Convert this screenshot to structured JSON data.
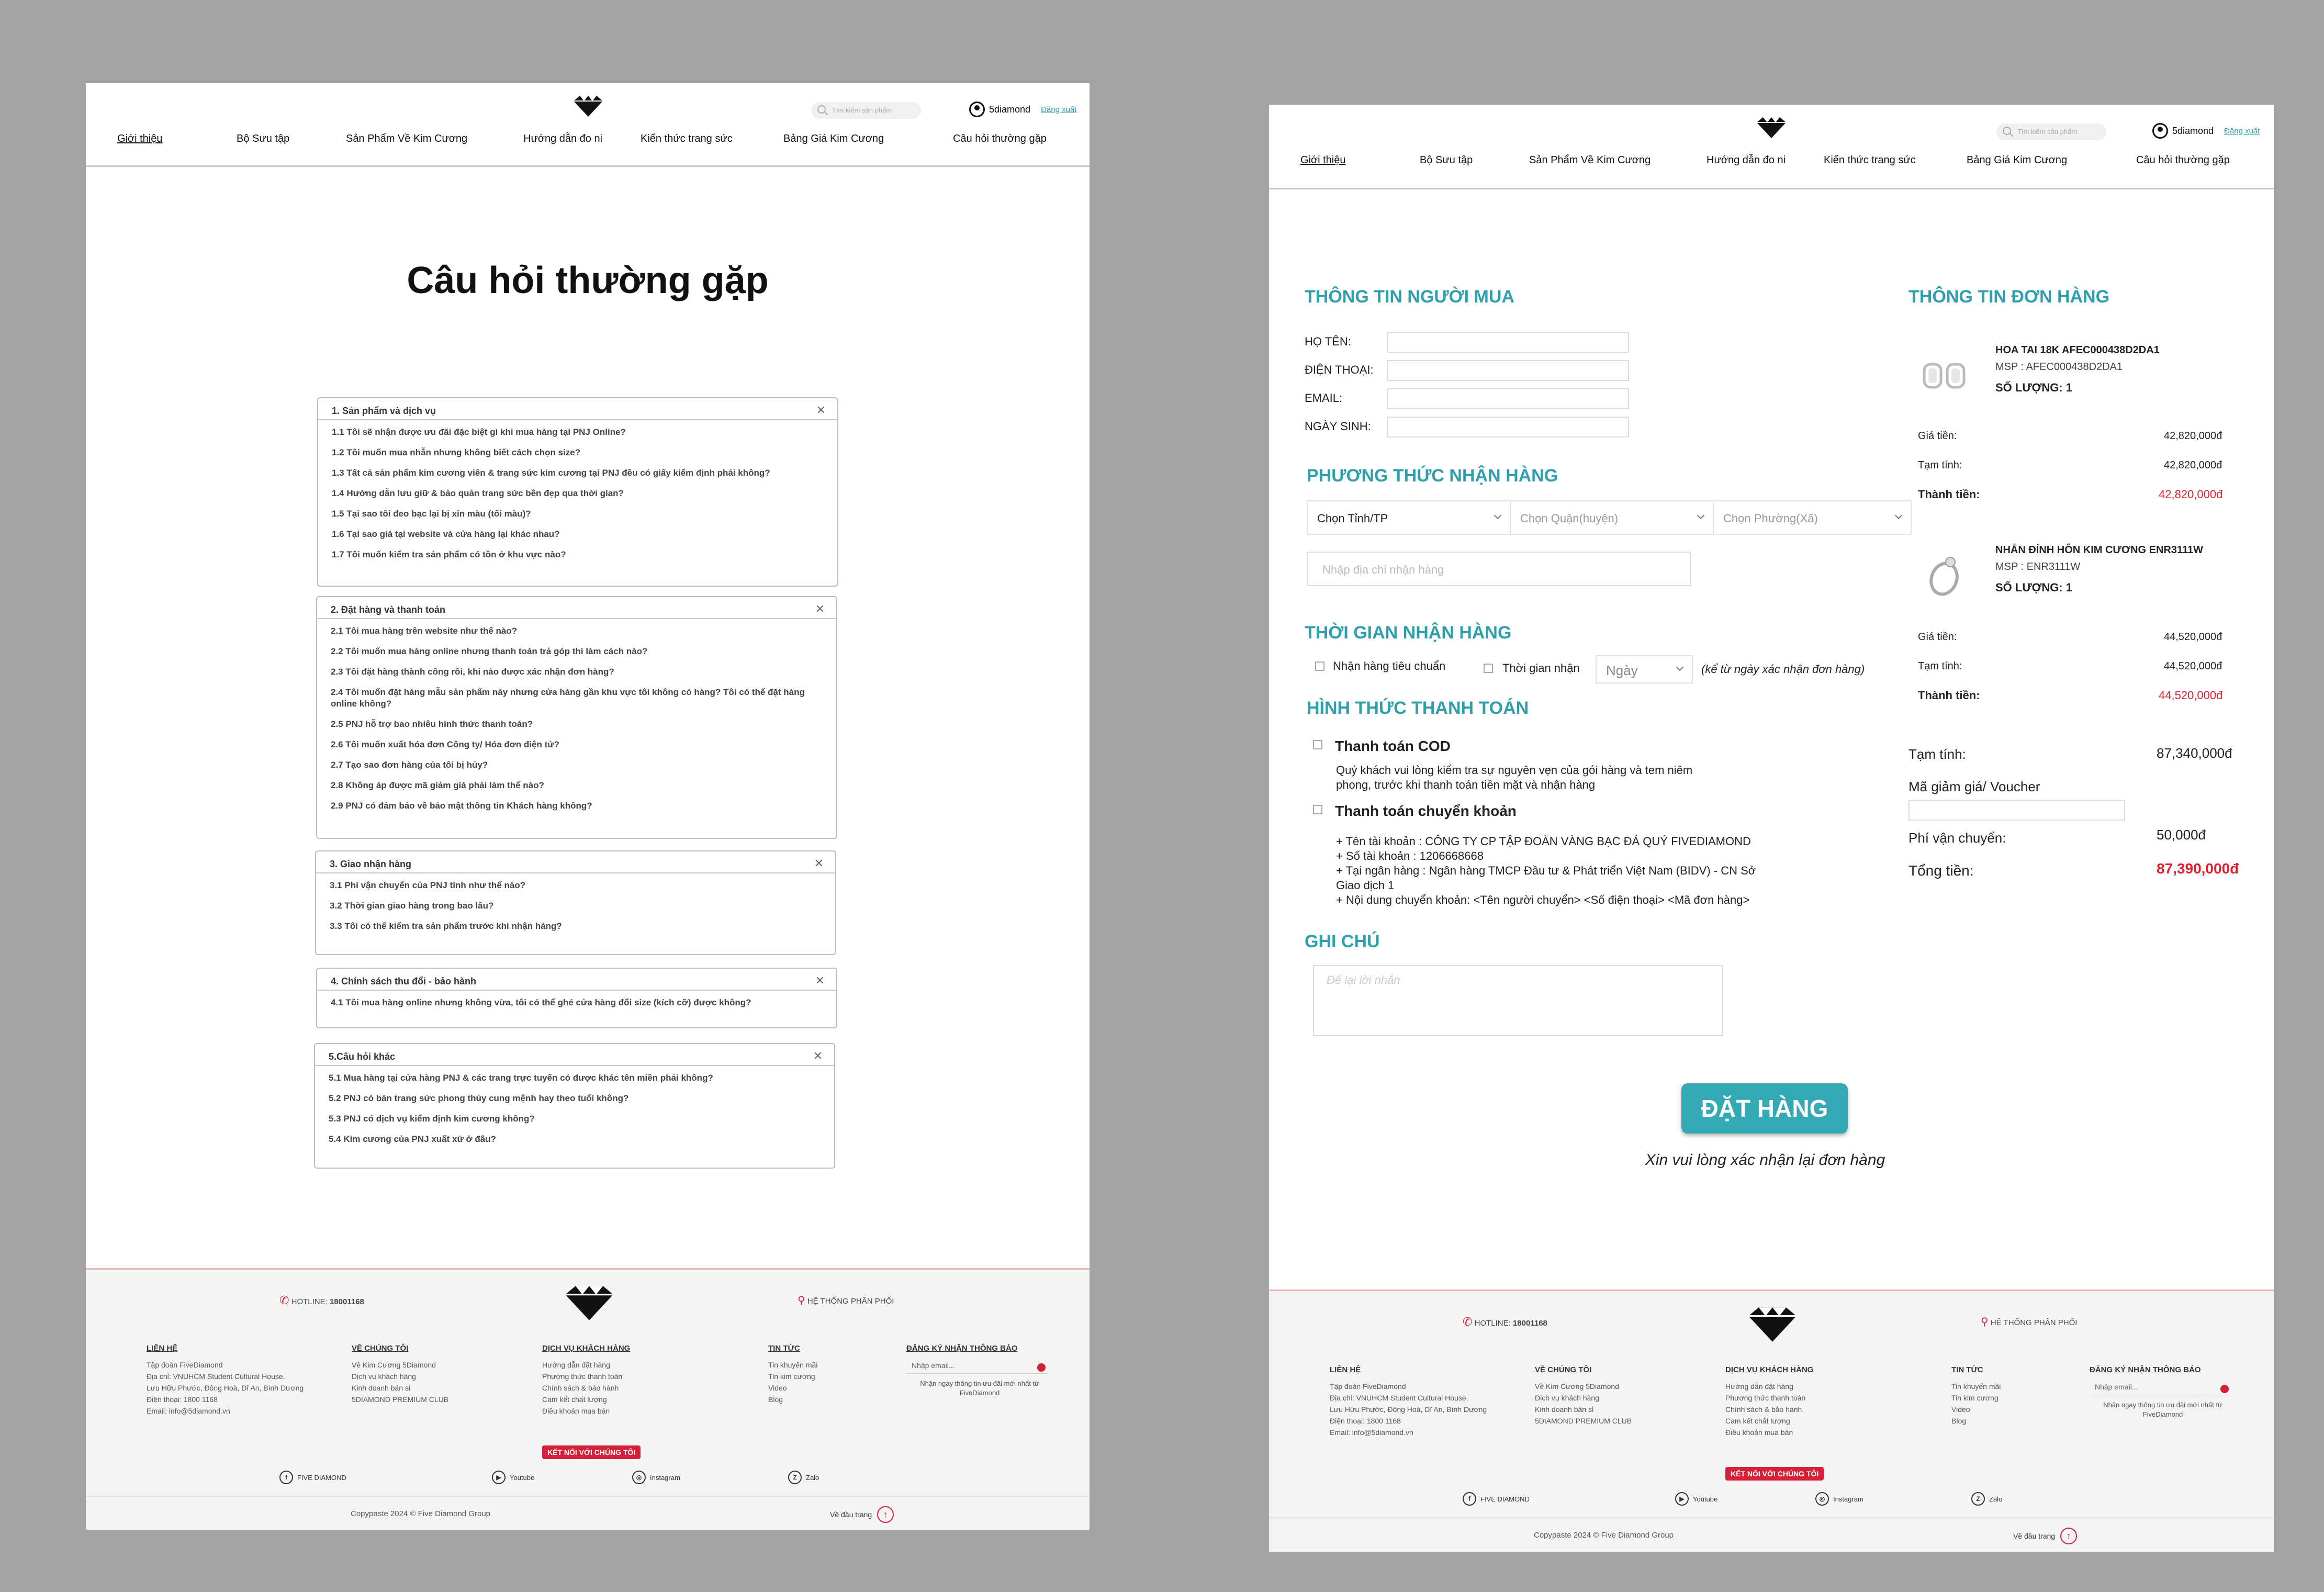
{
  "header": {
    "search_placeholder": "Tìm kiếm sản phẩm",
    "username": "5diamond",
    "logout": "Đăng xuất",
    "nav": [
      "Giới thiệu",
      "Bộ Sưu tập",
      "Sản Phẩm Về Kim Cương",
      "Hướng dẫn đo ni",
      "Kiến thức trang sức",
      "Bảng Giá Kim Cương",
      "Câu hỏi thường gặp"
    ]
  },
  "faq_page": {
    "title": "Câu hỏi thường gặp",
    "groups": [
      {
        "title": "1. Sản phẩm và dịch vụ",
        "items": [
          "1.1 Tôi sẽ nhận được ưu đãi đặc biệt gì khi mua hàng tại PNJ Online?",
          "1.2 Tôi muốn mua nhẫn nhưng không biết cách chọn size?",
          "1.3 Tất cả sản phẩm kim cương viên & trang sức kim cương tại PNJ đều có giấy kiểm định phải không?",
          "1.4 Hướng dẫn lưu giữ & bảo quản trang sức bền đẹp qua thời gian?",
          "1.5 Tại sao tôi đeo bạc lại bị xỉn màu (tối màu)?",
          "1.6 Tại sao giá tại website và cửa hàng lại khác nhau?",
          "1.7 Tôi muốn kiểm tra sản phẩm có tồn ở khu vực nào?"
        ]
      },
      {
        "title": "2. Đặt hàng và thanh toán",
        "items": [
          "2.1 Tôi mua hàng trên website như thế nào?",
          "2.2 Tôi muốn mua hàng online nhưng thanh toán trả góp thì làm cách nào?",
          "2.3 Tôi đặt hàng thành công rồi, khi nào được xác nhận đơn hàng?",
          "2.4 Tôi muốn đặt hàng mẫu sản phẩm này nhưng cửa hàng gần khu vực tôi không có hàng? Tôi có thể đặt hàng online không?",
          "2.5 PNJ hỗ trợ bao nhiêu hình thức thanh toán?",
          "2.6 Tôi muốn xuất hóa đơn Công ty/ Hóa đơn điện tử?",
          "2.7 Tạo sao đơn hàng của tôi bị hủy?",
          "2.8 Không áp được mã giảm giá phải làm thế nào?",
          "2.9 PNJ có đảm bảo về bảo mật thông tin Khách hàng không?"
        ]
      },
      {
        "title": "3. Giao nhận hàng",
        "items": [
          "3.1 Phí vận chuyển của PNJ tính như thế nào?",
          "3.2 Thời gian giao hàng trong bao lâu?",
          "3.3 Tôi có thể kiểm tra sản phẩm trước khi nhận hàng?"
        ]
      },
      {
        "title": "4. Chính sách thu đổi - bảo hành",
        "items": [
          "4.1 Tôi mua hàng online nhưng không vừa, tôi có thể ghé cửa hàng đổi size (kích cỡ) được không?"
        ]
      },
      {
        "title": "5.Câu hỏi khác",
        "items": [
          "5.1 Mua hàng tại cửa hàng PNJ & các trang trực tuyến có được khác tên miền phải không?",
          "5.2 PNJ có bán trang sức phong thủy cung mệnh hay theo tuổi không?",
          "5.3 PNJ có dịch vụ kiểm định kim cương không?",
          "5.4 Kim cương của PNJ xuất xứ ở đâu?"
        ]
      }
    ]
  },
  "footer": {
    "hotline_label": "HOTLINE:",
    "hotline": "18001168",
    "distribution": "HỆ THỐNG PHÂN PHỐI",
    "cols": [
      {
        "title": "LIÊN HỆ",
        "lines": [
          "Tập đoàn FiveDiamond",
          "Địa chỉ: VNUHCM Student Cultural House,",
          "Lưu Hữu Phước, Đông Hoà, Dĩ An, Bình Dương",
          "Điện thoại: 1800 1168",
          "Email: info@5diamond.vn"
        ]
      },
      {
        "title": "VỀ CHÚNG TÔI",
        "lines": [
          "Về Kim Cương 5Diamond",
          "Dịch vụ khách hàng",
          "Kinh doanh bán sỉ",
          "5DIAMOND PREMIUM CLUB"
        ]
      },
      {
        "title": "DỊCH VỤ KHÁCH HÀNG",
        "lines": [
          "Hướng dẫn đặt hàng",
          "Phương thức thanh toán",
          "Chính sách & bảo hành",
          "Cam kết chất lượng",
          "Điều khoản mua bán"
        ]
      },
      {
        "title": "TIN TỨC",
        "lines": [
          "Tin khuyến mãi",
          "Tin kim cương",
          "Video",
          "Blog"
        ]
      }
    ],
    "newsletter_title": "ĐĂNG KÝ NHẬN THÔNG BÁO",
    "newsletter_placeholder": "Nhập email...",
    "newsletter_note": "Nhận ngay thông tin ưu đãi mới nhất từ FiveDiamond",
    "connect": "KẾT NỐI VỚI CHÚNG TÔI",
    "social": [
      "FIVE DIAMOND",
      "Youtube",
      "Instagram",
      "Zalo"
    ],
    "copyright": "Copypaste 2024 © Five Diamond Group",
    "to_top": "Về đầu trang"
  },
  "checkout": {
    "buyer_title": "THÔNG TIN NGƯỜI MUA",
    "fields": [
      "HỌ TÊN:",
      "ĐIỆN THOẠI:",
      "EMAIL:",
      "NGÀY SINH:"
    ],
    "delivery_title": "PHƯƠNG THỨC NHẬN HÀNG",
    "province": "Chọn Tỉnh/TP",
    "district": "Chọn Quận(huyện)",
    "ward": "Chọn Phường(Xã)",
    "address_placeholder": "Nhập địa chỉ nhận hàng",
    "time_title": "THỜI GIAN NHẬN HÀNG",
    "time_standard": "Nhận hàng tiêu chuẩn",
    "time_custom": "Thời gian nhận",
    "day_select": "Ngày",
    "time_note": "(kể từ ngày xác nhận đơn hàng)",
    "payment_title": "HÌNH THỨC THANH TOÁN",
    "cod_title": "Thanh toán COD",
    "cod_desc": [
      "Quý khách vui lòng kiểm tra sự nguyên vẹn của gói hàng và tem niêm",
      "phong, trước khi thanh toán tiền mặt và nhận hàng"
    ],
    "transfer_title": "Thanh toán chuyển khoản",
    "transfer_lines": [
      "+ Tên tài khoản : CÔNG TY CP TẬP ĐOÀN VÀNG BẠC ĐÁ QUÝ FIVEDIAMOND",
      "+ Số tài khoản : 1206668668",
      "+ Tại ngân hàng : Ngân hàng TMCP Đầu tư & Phát triển Việt Nam (BIDV) - CN Sở",
      "Giao dịch 1",
      "+ Nội dung chuyển khoản: <Tên người chuyển> <Số điện thoại> <Mã đơn hàng>"
    ],
    "note_title": "GHI CHÚ",
    "note_placeholder": "Để lại lời nhắn",
    "order_button": "ĐẶT HÀNG",
    "confirm_text": "Xin vui lòng xác nhận lại đơn hàng",
    "order_title": "THÔNG TIN ĐƠN HÀNG",
    "products": [
      {
        "name": "HOA TAI 18K AFEC000438D2DA1",
        "sku": "MSP : AFEC000438D2DA1",
        "qty": "SỐ LƯỢNG: 1",
        "price_label": "Giá tiền:",
        "price": "42,820,000đ",
        "subtotal_label": "Tạm tính:",
        "subtotal": "42,820,000đ",
        "total_label": "Thành tiền:",
        "total": "42,820,000đ"
      },
      {
        "name": "NHẪN ĐÍNH HÔN KIM CƯƠNG ENR3111W",
        "sku": "MSP : ENR3111W",
        "qty": "SỐ LƯỢNG: 1",
        "price_label": "Giá tiền:",
        "price": "44,520,000đ",
        "subtotal_label": "Tạm tính:",
        "subtotal": "44,520,000đ",
        "total_label": "Thành tiền:",
        "total": "44,520,000đ"
      }
    ],
    "summary": {
      "subtotal_label": "Tạm tính:",
      "subtotal": "87,340,000đ",
      "voucher_label": "Mã giảm giá/ Voucher",
      "shipping_label": "Phí vận chuyển:",
      "shipping": "50,000đ",
      "total_label": "Tổng tiền:",
      "total": "87,390,000đ"
    }
  }
}
